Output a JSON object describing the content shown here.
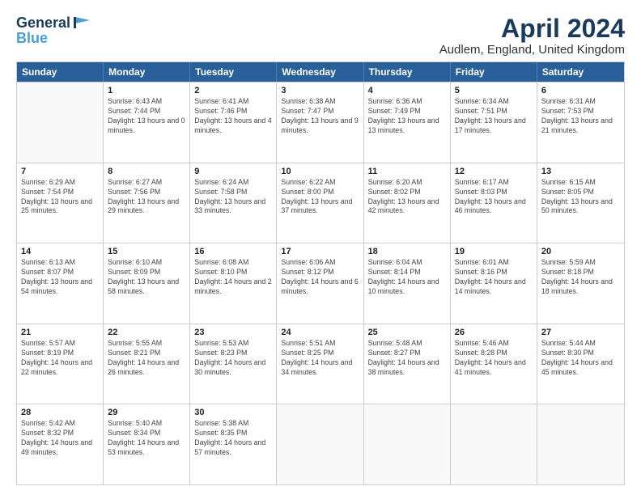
{
  "logo": {
    "line1": "General",
    "line2": "Blue"
  },
  "title": "April 2024",
  "location": "Audlem, England, United Kingdom",
  "days": [
    "Sunday",
    "Monday",
    "Tuesday",
    "Wednesday",
    "Thursday",
    "Friday",
    "Saturday"
  ],
  "weeks": [
    [
      {
        "day": "",
        "sunrise": "",
        "sunset": "",
        "daylight": ""
      },
      {
        "day": "1",
        "sunrise": "Sunrise: 6:43 AM",
        "sunset": "Sunset: 7:44 PM",
        "daylight": "Daylight: 13 hours and 0 minutes."
      },
      {
        "day": "2",
        "sunrise": "Sunrise: 6:41 AM",
        "sunset": "Sunset: 7:46 PM",
        "daylight": "Daylight: 13 hours and 4 minutes."
      },
      {
        "day": "3",
        "sunrise": "Sunrise: 6:38 AM",
        "sunset": "Sunset: 7:47 PM",
        "daylight": "Daylight: 13 hours and 9 minutes."
      },
      {
        "day": "4",
        "sunrise": "Sunrise: 6:36 AM",
        "sunset": "Sunset: 7:49 PM",
        "daylight": "Daylight: 13 hours and 13 minutes."
      },
      {
        "day": "5",
        "sunrise": "Sunrise: 6:34 AM",
        "sunset": "Sunset: 7:51 PM",
        "daylight": "Daylight: 13 hours and 17 minutes."
      },
      {
        "day": "6",
        "sunrise": "Sunrise: 6:31 AM",
        "sunset": "Sunset: 7:53 PM",
        "daylight": "Daylight: 13 hours and 21 minutes."
      }
    ],
    [
      {
        "day": "7",
        "sunrise": "Sunrise: 6:29 AM",
        "sunset": "Sunset: 7:54 PM",
        "daylight": "Daylight: 13 hours and 25 minutes."
      },
      {
        "day": "8",
        "sunrise": "Sunrise: 6:27 AM",
        "sunset": "Sunset: 7:56 PM",
        "daylight": "Daylight: 13 hours and 29 minutes."
      },
      {
        "day": "9",
        "sunrise": "Sunrise: 6:24 AM",
        "sunset": "Sunset: 7:58 PM",
        "daylight": "Daylight: 13 hours and 33 minutes."
      },
      {
        "day": "10",
        "sunrise": "Sunrise: 6:22 AM",
        "sunset": "Sunset: 8:00 PM",
        "daylight": "Daylight: 13 hours and 37 minutes."
      },
      {
        "day": "11",
        "sunrise": "Sunrise: 6:20 AM",
        "sunset": "Sunset: 8:02 PM",
        "daylight": "Daylight: 13 hours and 42 minutes."
      },
      {
        "day": "12",
        "sunrise": "Sunrise: 6:17 AM",
        "sunset": "Sunset: 8:03 PM",
        "daylight": "Daylight: 13 hours and 46 minutes."
      },
      {
        "day": "13",
        "sunrise": "Sunrise: 6:15 AM",
        "sunset": "Sunset: 8:05 PM",
        "daylight": "Daylight: 13 hours and 50 minutes."
      }
    ],
    [
      {
        "day": "14",
        "sunrise": "Sunrise: 6:13 AM",
        "sunset": "Sunset: 8:07 PM",
        "daylight": "Daylight: 13 hours and 54 minutes."
      },
      {
        "day": "15",
        "sunrise": "Sunrise: 6:10 AM",
        "sunset": "Sunset: 8:09 PM",
        "daylight": "Daylight: 13 hours and 58 minutes."
      },
      {
        "day": "16",
        "sunrise": "Sunrise: 6:08 AM",
        "sunset": "Sunset: 8:10 PM",
        "daylight": "Daylight: 14 hours and 2 minutes."
      },
      {
        "day": "17",
        "sunrise": "Sunrise: 6:06 AM",
        "sunset": "Sunset: 8:12 PM",
        "daylight": "Daylight: 14 hours and 6 minutes."
      },
      {
        "day": "18",
        "sunrise": "Sunrise: 6:04 AM",
        "sunset": "Sunset: 8:14 PM",
        "daylight": "Daylight: 14 hours and 10 minutes."
      },
      {
        "day": "19",
        "sunrise": "Sunrise: 6:01 AM",
        "sunset": "Sunset: 8:16 PM",
        "daylight": "Daylight: 14 hours and 14 minutes."
      },
      {
        "day": "20",
        "sunrise": "Sunrise: 5:59 AM",
        "sunset": "Sunset: 8:18 PM",
        "daylight": "Daylight: 14 hours and 18 minutes."
      }
    ],
    [
      {
        "day": "21",
        "sunrise": "Sunrise: 5:57 AM",
        "sunset": "Sunset: 8:19 PM",
        "daylight": "Daylight: 14 hours and 22 minutes."
      },
      {
        "day": "22",
        "sunrise": "Sunrise: 5:55 AM",
        "sunset": "Sunset: 8:21 PM",
        "daylight": "Daylight: 14 hours and 26 minutes."
      },
      {
        "day": "23",
        "sunrise": "Sunrise: 5:53 AM",
        "sunset": "Sunset: 8:23 PM",
        "daylight": "Daylight: 14 hours and 30 minutes."
      },
      {
        "day": "24",
        "sunrise": "Sunrise: 5:51 AM",
        "sunset": "Sunset: 8:25 PM",
        "daylight": "Daylight: 14 hours and 34 minutes."
      },
      {
        "day": "25",
        "sunrise": "Sunrise: 5:48 AM",
        "sunset": "Sunset: 8:27 PM",
        "daylight": "Daylight: 14 hours and 38 minutes."
      },
      {
        "day": "26",
        "sunrise": "Sunrise: 5:46 AM",
        "sunset": "Sunset: 8:28 PM",
        "daylight": "Daylight: 14 hours and 41 minutes."
      },
      {
        "day": "27",
        "sunrise": "Sunrise: 5:44 AM",
        "sunset": "Sunset: 8:30 PM",
        "daylight": "Daylight: 14 hours and 45 minutes."
      }
    ],
    [
      {
        "day": "28",
        "sunrise": "Sunrise: 5:42 AM",
        "sunset": "Sunset: 8:32 PM",
        "daylight": "Daylight: 14 hours and 49 minutes."
      },
      {
        "day": "29",
        "sunrise": "Sunrise: 5:40 AM",
        "sunset": "Sunset: 8:34 PM",
        "daylight": "Daylight: 14 hours and 53 minutes."
      },
      {
        "day": "30",
        "sunrise": "Sunrise: 5:38 AM",
        "sunset": "Sunset: 8:35 PM",
        "daylight": "Daylight: 14 hours and 57 minutes."
      },
      {
        "day": "",
        "sunrise": "",
        "sunset": "",
        "daylight": ""
      },
      {
        "day": "",
        "sunrise": "",
        "sunset": "",
        "daylight": ""
      },
      {
        "day": "",
        "sunrise": "",
        "sunset": "",
        "daylight": ""
      },
      {
        "day": "",
        "sunrise": "",
        "sunset": "",
        "daylight": ""
      }
    ]
  ]
}
